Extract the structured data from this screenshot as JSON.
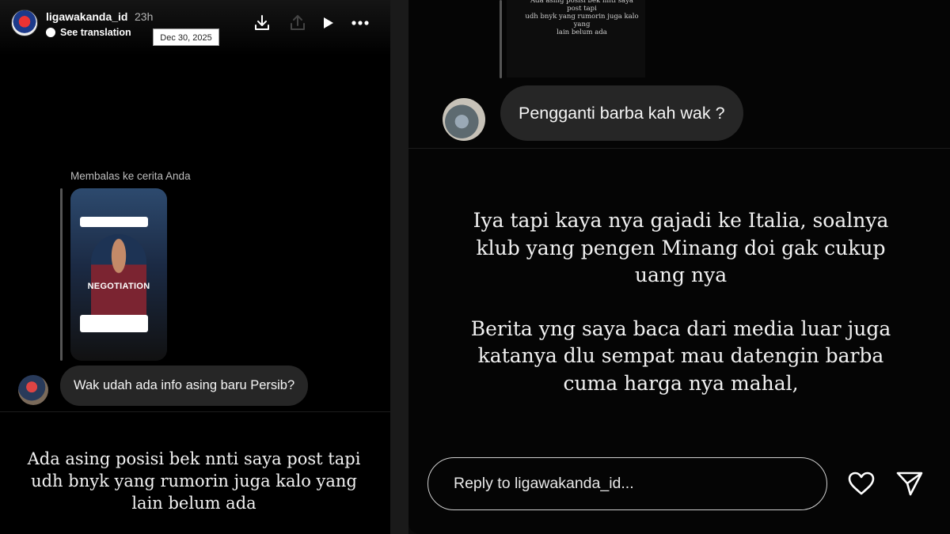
{
  "story_header": {
    "username": "ligawakanda_id",
    "time_ago": "23h",
    "translation_label": "See translation",
    "tooltip_date": "Dec 30, 2025"
  },
  "left_story": {
    "reply_caption": "Membalas ke cerita Anda",
    "story_thumbnail_label": "NEGOTIATION",
    "viewer_message": "Wak udah ada info asing baru Persib?",
    "reply_lines": [
      "Ada asing posisi bek nnti saya post tapi",
      "udh bnyk yang rumorin juga kalo yang",
      "lain belum ada"
    ]
  },
  "right_story": {
    "quoted_story_lines": [
      "Ada asing posisi bek nnti saya post tapi",
      "udh bnyk yang rumorin juga kalo yang",
      "lain belum ada"
    ],
    "viewer_message": "Pengganti barba kah wak ?",
    "reply_paragraph_1": [
      "Iya tapi kaya nya gajadi ke Italia, soalnya",
      "klub yang pengen Minang doi gak cukup",
      "uang nya"
    ],
    "reply_paragraph_2": [
      "Berita yng saya baca dari media luar juga",
      "katanya dlu sempat mau datengin barba",
      "cuma harga nya mahal,"
    ]
  },
  "reply_bar": {
    "placeholder": "Reply to ligawakanda_id..."
  },
  "icons": {
    "download": "download-icon",
    "share_story": "share-story-icon",
    "play": "play-icon",
    "more": "more-icon",
    "like": "heart-icon",
    "send": "send-icon"
  }
}
